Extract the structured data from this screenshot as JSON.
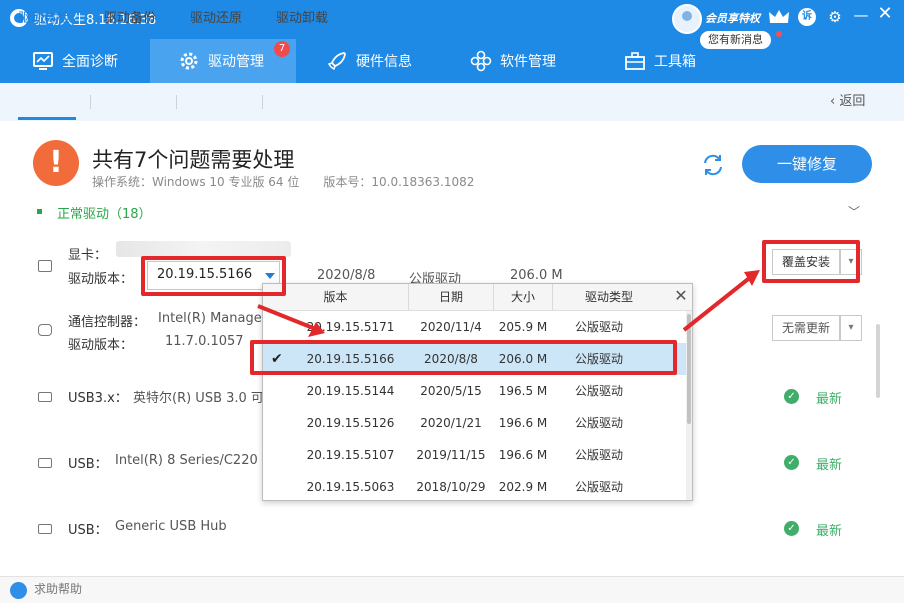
{
  "app": {
    "title": "驱动人生8.16.16.38",
    "member_label": "会员享特权",
    "message_bubble": "您有新消息",
    "complain_label": "诉",
    "colors": {
      "brand": "#1e8ae6",
      "active_tab": "#4aa3ef",
      "warning": "#f26b3a",
      "ok": "#3fae6a",
      "highlight": "#e3282b"
    }
  },
  "nav": {
    "tabs": [
      {
        "label": "全面诊断",
        "icon": "monitor-icon"
      },
      {
        "label": "驱动管理",
        "icon": "gear-icon",
        "badge": "7"
      },
      {
        "label": "硬件信息",
        "icon": "rocket-icon"
      },
      {
        "label": "软件管理",
        "icon": "flower-icon"
      },
      {
        "label": "工具箱",
        "icon": "toolbox-icon"
      }
    ]
  },
  "subnav": {
    "items": [
      "驱动体检",
      "驱动备份",
      "驱动还原",
      "驱动卸载"
    ],
    "back": "返回"
  },
  "summary": {
    "title": "共有7个问题需要处理",
    "system_info": "操作系统：Windows 10 专业版 64 位　　版本号：10.0.18363.1082",
    "fix_button": "一键修复",
    "normal_drivers": "正常驱动（18）"
  },
  "drivers": {
    "gpu": {
      "label": "显卡：",
      "version_label": "驱动版本：",
      "version": "20.19.15.5166",
      "date": "2020/8/8",
      "type": "公版驱动",
      "size": "206.0 M",
      "action": "覆盖安装"
    },
    "comm": {
      "label": "通信控制器：",
      "name": "Intel(R) Manage",
      "version_label": "驱动版本：",
      "version": "11.7.0.1057",
      "action": "无需更新"
    },
    "usb3": {
      "label": "USB3.x：",
      "name": "英特尔(R) USB 3.0 可",
      "status": "最新"
    },
    "usb": {
      "label": "USB：",
      "name": "Intel(R) 8 Series/C220",
      "status": "最新"
    },
    "usbhub": {
      "label": "USB：",
      "name": "Generic USB Hub",
      "status": "最新"
    }
  },
  "popup": {
    "columns": [
      "版本",
      "日期",
      "大小",
      "驱动类型"
    ],
    "rows": [
      {
        "version": "20.19.15.5171",
        "date": "2020/11/4",
        "size": "205.9 M",
        "type": "公版驱动"
      },
      {
        "version": "20.19.15.5166",
        "date": "2020/8/8",
        "size": "206.0 M",
        "type": "公版驱动",
        "selected": true
      },
      {
        "version": "20.19.15.5144",
        "date": "2020/5/15",
        "size": "196.5 M",
        "type": "公版驱动"
      },
      {
        "version": "20.19.15.5126",
        "date": "2020/1/21",
        "size": "196.6 M",
        "type": "公版驱动"
      },
      {
        "version": "20.19.15.5107",
        "date": "2019/11/15",
        "size": "196.6 M",
        "type": "公版驱动"
      },
      {
        "version": "20.19.15.5063",
        "date": "2018/10/29",
        "size": "202.9 M",
        "type": "公版驱动"
      }
    ]
  },
  "footer": {
    "text": "求助帮助"
  }
}
